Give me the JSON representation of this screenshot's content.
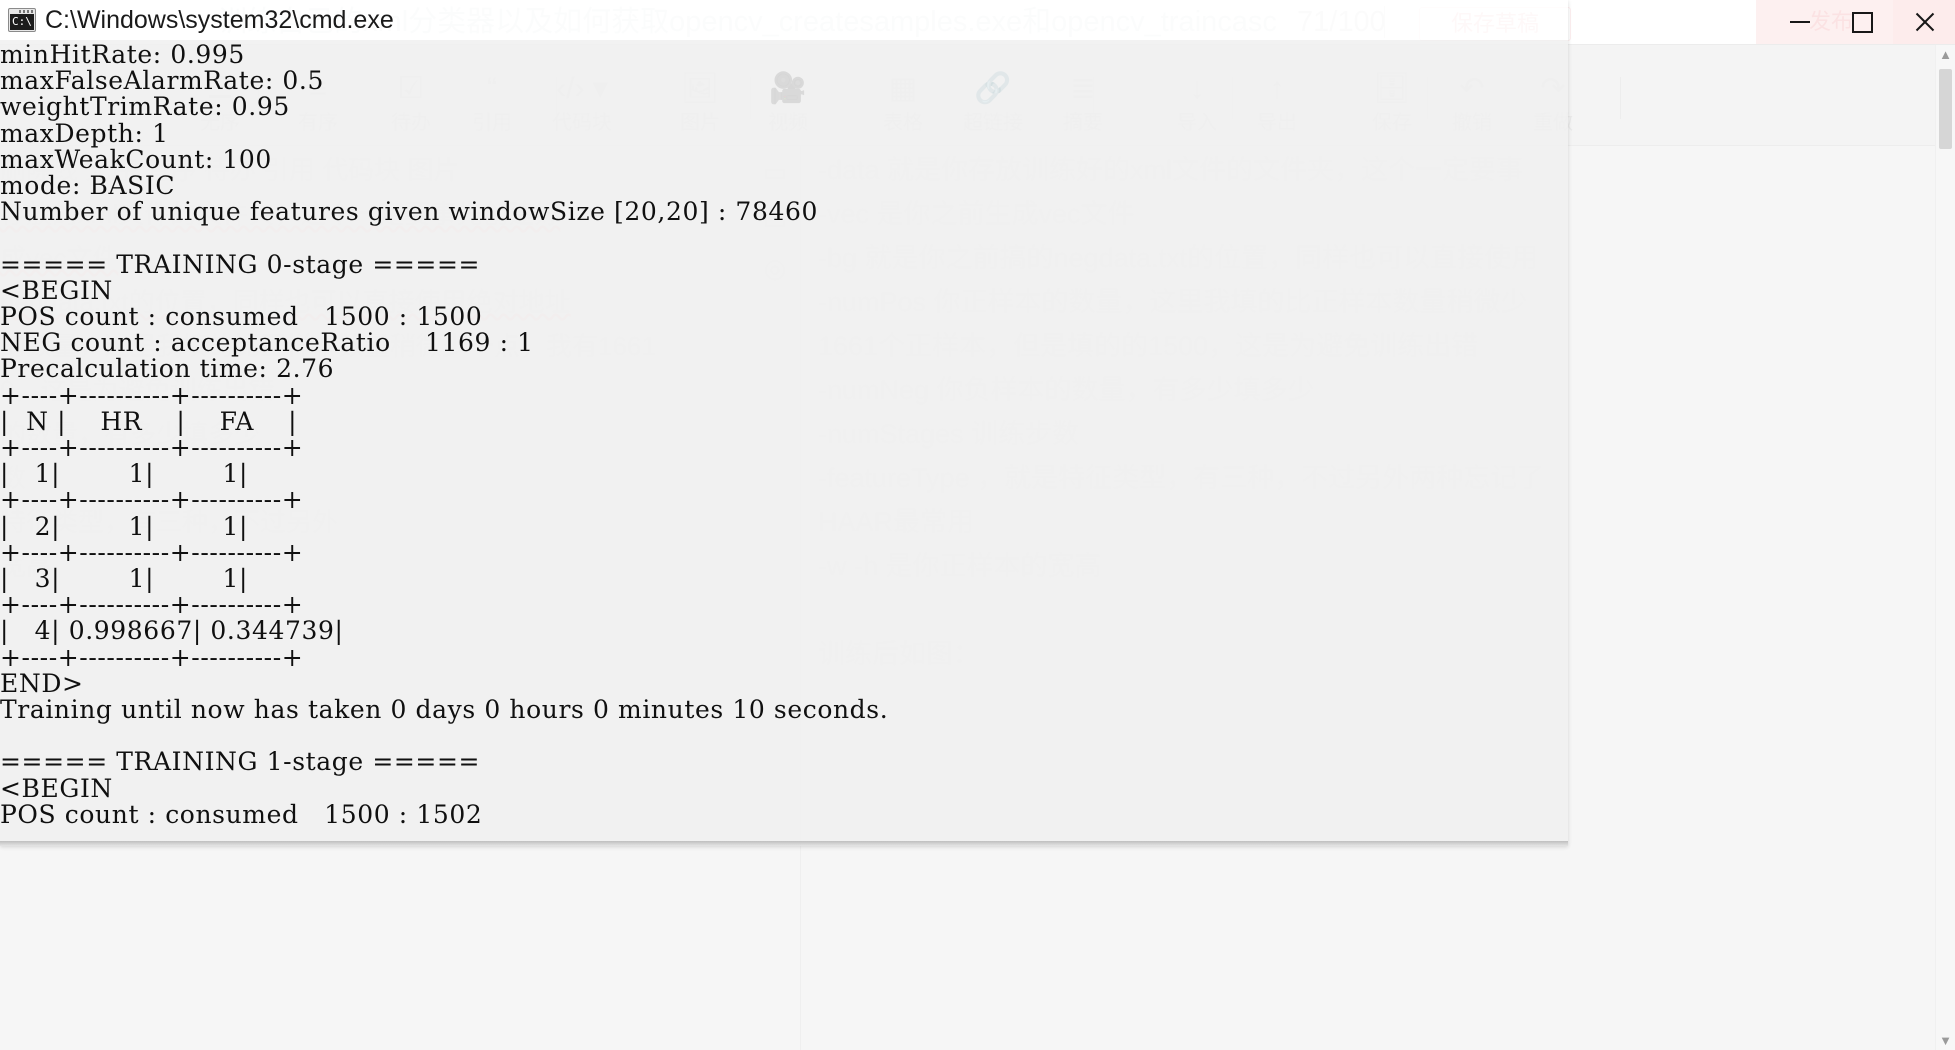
{
  "background_editor": {
    "article_title": "训练自己的xml分类器以及如何获取opencv_createsamples.exe和opencv_traincascade.e",
    "word_counter": "71/100",
    "save_draft_label": "保存草稿",
    "publish_label": "发布",
    "toolbar": [
      {
        "label": "无序",
        "icon": "unordered-list-icon",
        "glyph": "☰"
      },
      {
        "label": "有序",
        "icon": "ordered-list-icon",
        "glyph": "≡"
      },
      {
        "label": "待办",
        "icon": "todo-list-icon",
        "glyph": "☑"
      },
      {
        "label": "引用",
        "icon": "quote-icon",
        "glyph": "“"
      },
      {
        "label": "代码块",
        "icon": "code-block-icon",
        "glyph": "‹/›"
      },
      {
        "label": "图片",
        "icon": "image-icon",
        "glyph": "ὛB"
      },
      {
        "label": "视频",
        "icon": "video-icon",
        "glyph": "▶"
      },
      {
        "label": "表格",
        "icon": "table-icon",
        "glyph": "⌗"
      },
      {
        "label": "超链接",
        "icon": "link-icon",
        "glyph": "⚭"
      },
      {
        "label": "摘要",
        "icon": "summary-icon",
        "glyph": "≣"
      },
      {
        "label": "导入",
        "icon": "import-icon",
        "glyph": "↓"
      },
      {
        "label": "导出",
        "icon": "export-icon",
        "glyph": "↑"
      },
      {
        "label": "保存",
        "icon": "save-icon",
        "glyph": "▢"
      },
      {
        "label": "撤销",
        "icon": "undo-icon",
        "glyph": "↶"
      },
      {
        "label": "重做",
        "icon": "redo-icon",
        "glyph": "↷"
      }
    ],
    "rail_icons": [
      {
        "icon": "single-column-view-icon",
        "glyph": "▭"
      },
      {
        "icon": "split-view-icon",
        "glyph": "▥"
      },
      {
        "icon": "preview-eye-icon",
        "glyph": "◎"
      }
    ],
    "source_lines": [
      "删除线       无序    有序    待办    引用    代码块      图片",
      "存放的xml文件的文件夹，这个一定要事先创建好",
      "成vec文件",
      "negdata.txt的位置，同样也可以直接使用绝对地址",
      "的数量，这里我填的比正样本数量稍微少一点，我有1661",
      "0，这是为避免训练出错",
      "的数量，有多少填多少",
      "数",
      "特征类型，有三种，不过另外",
      "宽高"
    ],
    "preview_lines": [
      "-data 就是你存放训练好的xml文件的文件夹，这个一定要事",
      "-vec 是你之前生成vec文件",
      "-bg 就是你之前搞的negdata.txt的位置，同样也可以直接使用",
      "-numPos 你正样本的数量，这里我填的比正样本数量稍微少",
      "1661个正样本，但是填的的1500，这是为避免训练出错",
      "-numNeg 你负样本的数量，有多少填多少",
      "-numStages 训练步数",
      "-featureType ，就是特征类型，有三种，不过另外两种忘记了",
      "HAAR最常用",
      "-w -h 是你正样本的宽高",
      "",
      "训练后如图："
    ]
  },
  "window_controls": {
    "minimize_label": "minimize",
    "maximize_label": "maximize",
    "close_label": "close"
  },
  "console": {
    "title": "C:\\Windows\\system32\\cmd.exe",
    "icon": "cmd-console-icon",
    "output": "minHitRate: 0.995\nmaxFalseAlarmRate: 0.5\nweightTrimRate: 0.95\nmaxDepth: 1\nmaxWeakCount: 100\nmode: BASIC\nNumber of unique features given windowSize [20,20] : 78460\n\n===== TRAINING 0-stage =====\n<BEGIN\nPOS count : consumed   1500 : 1500\nNEG count : acceptanceRatio    1169 : 1\nPrecalculation time: 2.76\n+----+----------+----------+\n|  N |    HR    |    FA    |\n+----+----------+----------+\n|   1|        1|        1|\n+----+----------+----------+\n|   2|        1|        1|\n+----+----------+----------+\n|   3|        1|        1|\n+----+----------+----------+\n|   4| 0.998667| 0.344739|\n+----+----------+----------+\nEND>\nTraining until now has taken 0 days 0 hours 0 minutes 10 seconds.\n\n===== TRAINING 1-stage =====\n<BEGIN\nPOS count : consumed   1500 : 1502",
    "params": {
      "minHitRate": "0.995",
      "maxFalseAlarmRate": "0.5",
      "weightTrimRate": "0.95",
      "maxDepth": "1",
      "maxWeakCount": "100",
      "mode": "BASIC",
      "windowSize": "[20,20]",
      "unique_features": "78460"
    },
    "stage0": {
      "header": "===== TRAINING 0-stage =====",
      "pos_count_consumed": "1500 : 1500",
      "neg_count_acceptance_ratio": "1169 : 1",
      "precalculation_time": "2.76",
      "columns": [
        "N",
        "HR",
        "FA"
      ],
      "rows": [
        [
          "1",
          "1",
          "1"
        ],
        [
          "2",
          "1",
          "1"
        ],
        [
          "3",
          "1",
          "1"
        ],
        [
          "4",
          "0.998667",
          "0.344739"
        ]
      ],
      "elapsed": "Training until now has taken 0 days 0 hours 0 minutes 10 seconds."
    },
    "stage1": {
      "header": "===== TRAINING 1-stage =====",
      "pos_count_consumed": "1500 : 1502"
    }
  },
  "scrollbar": {
    "up_arrow": "▲",
    "down_arrow": "▼"
  }
}
